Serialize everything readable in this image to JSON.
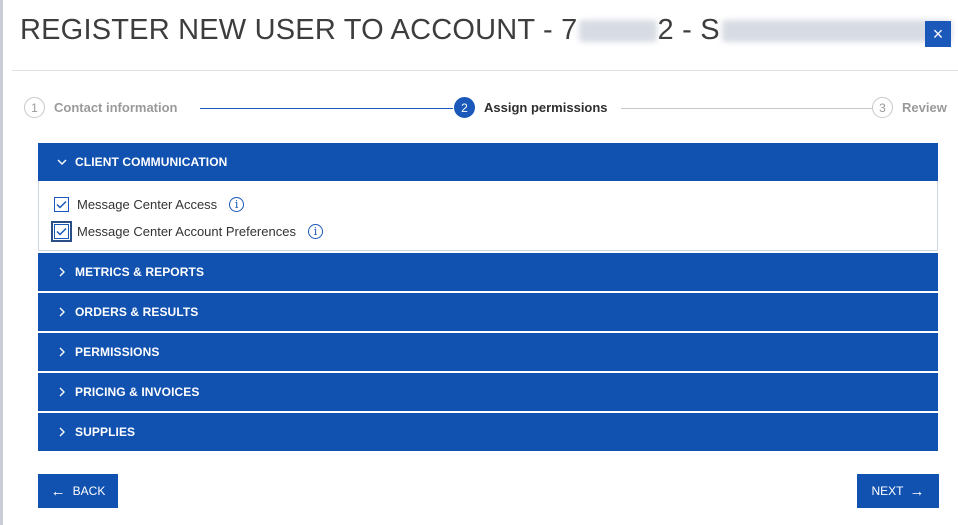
{
  "header": {
    "title_prefix": "REGISTER NEW USER TO ACCOUNT - 7",
    "title_mid": "2 - S",
    "title_suffix": "1",
    "close_label": "×"
  },
  "stepper": {
    "steps": [
      {
        "number": "1",
        "label": "Contact information",
        "state": "completed"
      },
      {
        "number": "2",
        "label": "Assign permissions",
        "state": "active"
      },
      {
        "number": "3",
        "label": "Review",
        "state": "pending"
      }
    ]
  },
  "sections": [
    {
      "label": "CLIENT COMMUNICATION",
      "expanded": true,
      "permissions": [
        {
          "label": "Message Center Access",
          "checked": true
        },
        {
          "label": "Message Center Account Preferences",
          "checked": true
        }
      ]
    },
    {
      "label": "METRICS & REPORTS",
      "expanded": false
    },
    {
      "label": "ORDERS & RESULTS",
      "expanded": false
    },
    {
      "label": "PERMISSIONS",
      "expanded": false
    },
    {
      "label": "PRICING & INVOICES",
      "expanded": false
    },
    {
      "label": "SUPPLIES",
      "expanded": false
    }
  ],
  "footer": {
    "back_label": "BACK",
    "next_label": "NEXT"
  },
  "colors": {
    "primary": "#1152b0",
    "step_active": "#1a58b9",
    "step_inactive": "#c8c8c8"
  },
  "icons": {
    "close": "close-icon",
    "expand": "chevron-down-icon",
    "collapse": "chevron-right-icon",
    "info": "info-icon",
    "back": "arrow-left-icon",
    "next": "arrow-right-icon"
  }
}
